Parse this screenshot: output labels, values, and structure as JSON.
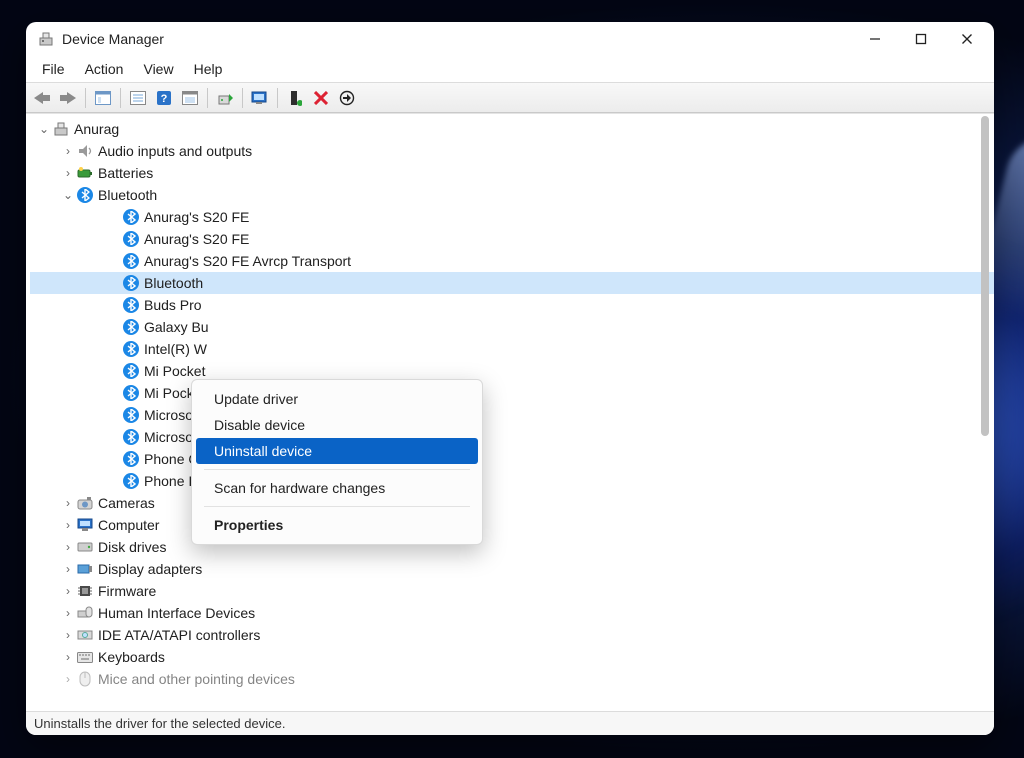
{
  "window": {
    "title": "Device Manager"
  },
  "menu": {
    "file": "File",
    "action": "Action",
    "view": "View",
    "help": "Help"
  },
  "tree": {
    "root": "Anurag",
    "cat": {
      "audio": "Audio inputs and outputs",
      "batteries": "Batteries",
      "bluetooth": "Bluetooth",
      "cameras": "Cameras",
      "computer": "Computer",
      "disk": "Disk drives",
      "display": "Display adapters",
      "firmware": "Firmware",
      "hid": "Human Interface Devices",
      "ide": "IDE ATA/ATAPI controllers",
      "keyboards": "Keyboards",
      "mice": "Mice and other pointing devices"
    },
    "bt": {
      "i0": "Anurag's S20 FE",
      "i1": "Anurag's S20 FE",
      "i2": "Anurag's S20 FE Avrcp Transport",
      "i3": "Bluetooth",
      "i4": "Buds Pro",
      "i5": "Galaxy Bu",
      "i6": "Intel(R) W",
      "i7": "Mi Pocket",
      "i8": "Mi Pocket",
      "i9": "Microsoft",
      "i10": "Microsoft Bluetooth LE Enumerator",
      "i11": "Phone Call Audio Device",
      "i12": "Phone Input Device v2"
    }
  },
  "context_menu": {
    "update": "Update driver",
    "disable": "Disable device",
    "uninstall": "Uninstall device",
    "scan": "Scan for hardware changes",
    "properties": "Properties"
  },
  "status": "Uninstalls the driver for the selected device."
}
